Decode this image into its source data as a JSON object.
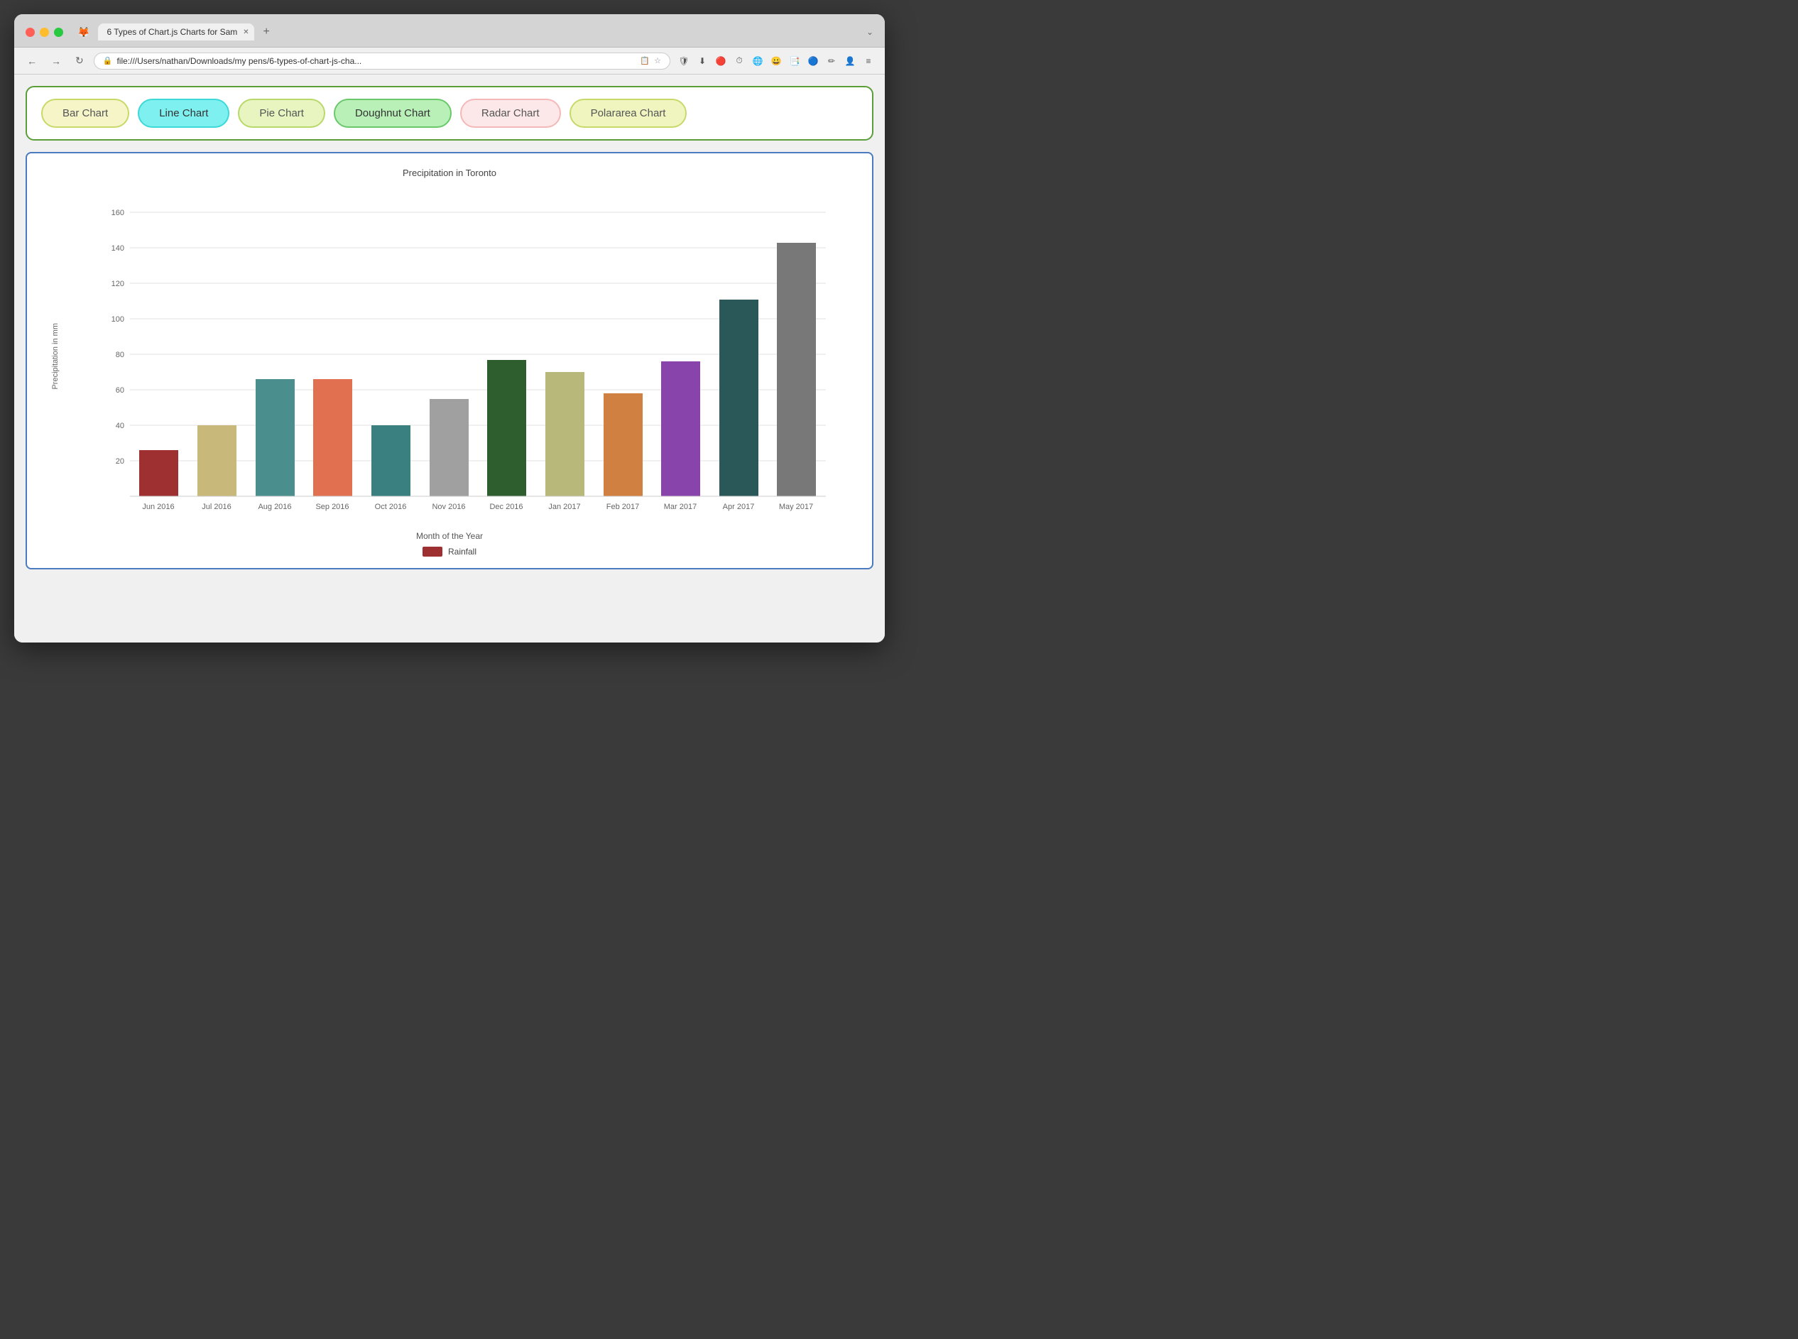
{
  "browser": {
    "tab_title": "6 Types of Chart.js Charts for Sam",
    "url": "file:///Users/nathan/Downloads/my pens/6-types-of-chart-js-cha...",
    "favicon": "🦊"
  },
  "nav_buttons": [
    {
      "id": "bar",
      "label": "Bar Chart",
      "class": "btn-bar"
    },
    {
      "id": "line",
      "label": "Line Chart",
      "class": "btn-line"
    },
    {
      "id": "pie",
      "label": "Pie Chart",
      "class": "btn-pie"
    },
    {
      "id": "doughnut",
      "label": "Doughnut Chart",
      "class": "btn-doughnut"
    },
    {
      "id": "radar",
      "label": "Radar Chart",
      "class": "btn-radar"
    },
    {
      "id": "polararea",
      "label": "Polararea Chart",
      "class": "btn-polararea"
    }
  ],
  "chart": {
    "title": "Precipitation in Toronto",
    "y_label": "Precipitation in mm",
    "x_label": "Month of the Year",
    "legend_label": "Rainfall",
    "legend_color": "#9e3031",
    "y_ticks": [
      20,
      40,
      60,
      80,
      100,
      120,
      140,
      160
    ],
    "bars": [
      {
        "month": "Jun 2016",
        "value": 26,
        "color": "#9e3031"
      },
      {
        "month": "Jul 2016",
        "value": 40,
        "color": "#c8b87a"
      },
      {
        "month": "Aug 2016",
        "value": 66,
        "color": "#4a8e8e"
      },
      {
        "month": "Sep 2016",
        "value": 66,
        "color": "#e07050"
      },
      {
        "month": "Oct 2016",
        "value": 40,
        "color": "#3a8080"
      },
      {
        "month": "Nov 2016",
        "value": 55,
        "color": "#a0a0a0"
      },
      {
        "month": "Dec 2016",
        "value": 77,
        "color": "#2e5e2e"
      },
      {
        "month": "Jan 2017",
        "value": 70,
        "color": "#b8b87a"
      },
      {
        "month": "Feb 2017",
        "value": 58,
        "color": "#d08040"
      },
      {
        "month": "Mar 2017",
        "value": 76,
        "color": "#8844aa"
      },
      {
        "month": "Apr 2017",
        "value": 111,
        "color": "#2a5858"
      },
      {
        "month": "May 2017",
        "value": 143,
        "color": "#787878"
      }
    ]
  }
}
